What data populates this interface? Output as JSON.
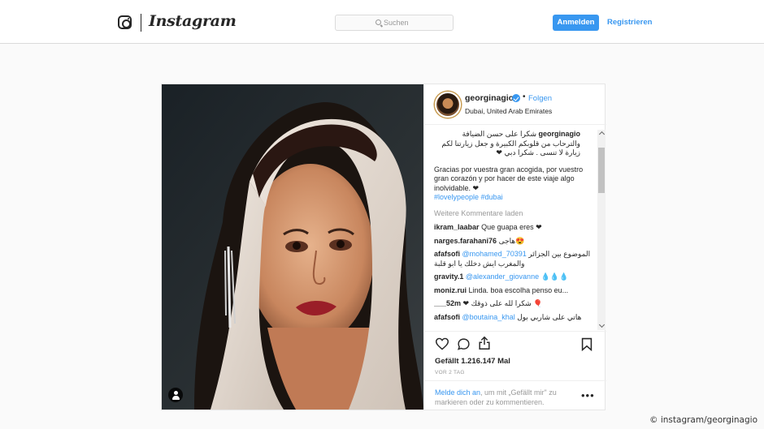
{
  "header": {
    "wordmark": "Instagram",
    "search_placeholder": "Suchen",
    "login_label": "Anmelden",
    "register_label": "Registrieren"
  },
  "post": {
    "username": "georginagio",
    "follow_label": "Folgen",
    "dot": "•",
    "location": "Dubai, United Arab Emirates",
    "caption_ar": "شكرا على حسن الضيافة والترحاب من قلوبكم الكبيرة و جعل زيارتنا لكم زيارة لا تنسى . شكرا دبي ❤",
    "caption_es": "Gracias por vuestra gran acogida, por vuestro gran corazón y por hacer de este viaje algo inolvidable. ❤",
    "hashtags": "#lovelypeople #dubai",
    "more_comments": "Weitere Kommentare laden",
    "comments": [
      {
        "user": "ikram_laabar",
        "mention": "",
        "text": "Que guapa eres ❤"
      },
      {
        "user": "narges.farahani76",
        "mention": "",
        "text": "هاجی😍"
      },
      {
        "user": "afafsofi",
        "mention": "@mohamed_70391",
        "text": "الموضوع بين الجزائر والمغرب ايش دخلك يا ابو قلبة"
      },
      {
        "user": "gravity.1",
        "mention": "@alexander_giovanne",
        "text": "💧💧💧"
      },
      {
        "user": "moniz.rui",
        "mention": "",
        "text": "Linda. boa escolha penso eu..."
      },
      {
        "user": "___52m",
        "mention": "",
        "text": "❤ شكرا لله على ذوقك 🎈"
      },
      {
        "user": "afafsofi",
        "mention": "@boutaina_khal",
        "text": "هاتي على شاربي بول"
      }
    ],
    "likes": "Gefällt 1.216.147 Mal",
    "time": "VOR 2 TAG",
    "login_prompt_link": "Melde dich an",
    "login_prompt_rest": ", um mit „Gefällt mir\" zu markieren oder zu kommentieren.",
    "more_options": "•••"
  },
  "credit": "© instagram/georginagio",
  "colors": {
    "accent": "#3897f0",
    "text": "#262626",
    "muted": "#999999",
    "background": "#fafafa"
  }
}
